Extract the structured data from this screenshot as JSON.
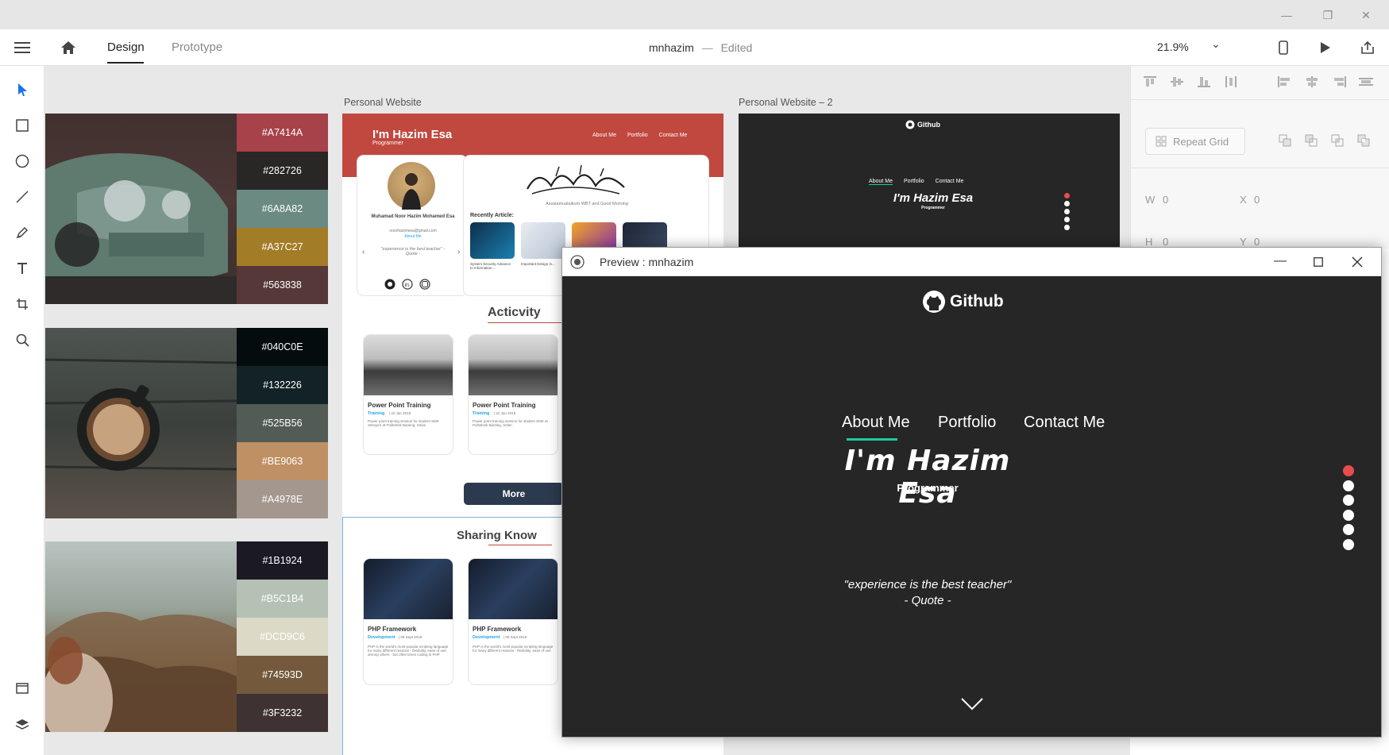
{
  "window": {
    "minimize": "—",
    "restore": "❐",
    "close": "✕"
  },
  "topbar": {
    "menu_icon": "hamburger-icon",
    "home_icon": "home-icon",
    "tabs": [
      {
        "label": "Design"
      },
      {
        "label": "Prototype"
      }
    ],
    "doc_name": "mnhazim",
    "doc_sep": "—",
    "doc_status": "Edited",
    "zoom": "21.9%"
  },
  "props": {
    "repeat_grid": "Repeat Grid",
    "w_label": "W",
    "w_value": "0",
    "x_label": "X",
    "x_value": "0",
    "h_label": "H",
    "h_value": "0",
    "y_label": "Y",
    "y_value": "0"
  },
  "palettes": [
    {
      "colors": [
        "#A7414A",
        "#282726",
        "#6A8A82",
        "#A37C27",
        "#563838"
      ]
    },
    {
      "colors": [
        "#040C0E",
        "#132226",
        "#525B56",
        "#BE9063",
        "#A4978E"
      ]
    },
    {
      "colors": [
        "#1B1924",
        "#B5C1B4",
        "#DCD9C6",
        "#74593D",
        "#3F3232"
      ]
    }
  ],
  "artboard1": {
    "label": "Personal Website",
    "title": "I'm Hazim Esa",
    "subtitle": "Programmer",
    "nav": [
      "About Me",
      "Portfolio",
      "Contact Me"
    ],
    "profile_name": "Muhamad Noor Hazim Mohamed Esa",
    "profile_email": "noorhazimesa@gmail.com",
    "profile_link": "About Me",
    "quote": "\"experience is the best teacher\" - Quote -",
    "greeting": "Assalamualaikum WBT and Good Morning",
    "recently": "Recently Article:",
    "article1": "System Security Advance to Information...",
    "article2": "Important Design in...",
    "activity_heading": "Acticvity",
    "activity_cards": [
      {
        "title": "Power Point Training",
        "tag": "Training",
        "date": "| 22 Jan 2018",
        "desc": "Power point training session for student SMK Seksyen at Politeknik Banting, Selan"
      },
      {
        "title": "Power Point Training",
        "tag": "Training",
        "date": "| 22 Jan 2018",
        "desc": "Power point training session for student SMK at Politeknik Banting, Selan"
      }
    ],
    "more": "More",
    "sharing_heading": "Sharing Know",
    "sharing_cards": [
      {
        "title": "PHP Framework",
        "tag": "Development",
        "date": "| 09 Sept 2019",
        "desc": "PHP is the world's most popular scripting language for many different reasons - flexibility, ease of use, among others - but often times coding in PHP"
      },
      {
        "title": "PHP Framework",
        "tag": "Development",
        "date": "| 09 Sept 2019",
        "desc": "PHP is the world's most popular scripting language for many different reasons - flexibility, ease of use"
      }
    ]
  },
  "artboard2": {
    "label": "Personal Website – 2",
    "logo": "Github",
    "nav": [
      "About Me",
      "Portfolio",
      "Contact Me"
    ],
    "title": "I'm Hazim Esa",
    "subtitle": "Programmer"
  },
  "preview": {
    "window_title": "Preview : mnhazim",
    "logo": "Github",
    "nav": [
      "About Me",
      "Portfolio",
      "Contact Me"
    ],
    "title": "I'm Hazim Esa",
    "subtitle": "Programmer",
    "quote": "\"experience is the best teacher\"",
    "quote_author": "- Quote -",
    "accent": "#e84c4c",
    "active_underline": "#1ec9a5"
  }
}
